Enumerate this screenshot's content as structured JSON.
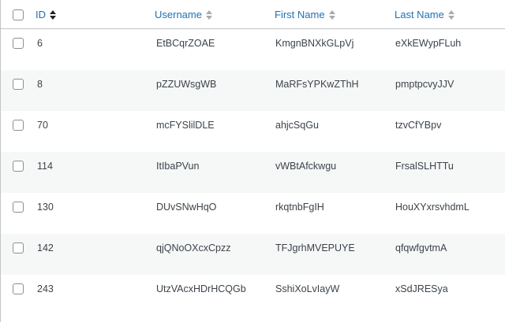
{
  "columns": {
    "id": "ID",
    "username": "Username",
    "first_name": "First Name",
    "last_name": "Last Name"
  },
  "rows": [
    {
      "id": "6",
      "username": "EtBCqrZOAE",
      "first_name": "KmgnBNXkGLpVj",
      "last_name": "eXkEWypFLuh"
    },
    {
      "id": "8",
      "username": "pZZUWsgWB",
      "first_name": "MaRFsYPKwZThH",
      "last_name": "pmptpcvyJJV"
    },
    {
      "id": "70",
      "username": "mcFYSlilDLE",
      "first_name": "ahjcSqGu",
      "last_name": "tzvCfYBpv"
    },
    {
      "id": "114",
      "username": "ItIbaPVun",
      "first_name": "vWBtAfckwgu",
      "last_name": "FrsalSLHTTu"
    },
    {
      "id": "130",
      "username": "DUvSNwHqO",
      "first_name": "rkqtnbFgIH",
      "last_name": "HouXYxrsvhdmL"
    },
    {
      "id": "142",
      "username": "qjQNoOXcxCpzz",
      "first_name": "TFJgrhMVEPUYE",
      "last_name": "qfqwfgvtmA"
    },
    {
      "id": "243",
      "username": "UtzVAcxHDrHCQGb",
      "first_name": "SshiXoLvIayW",
      "last_name": "xSdJRESya"
    }
  ],
  "colors": {
    "link": "#2271b1",
    "text": "#3c434a",
    "row_alt": "#f6f7f7",
    "border": "#c3c4c7"
  },
  "icons": {
    "sort_active": "sort-asc-icon",
    "sort_inactive": "sort-icon"
  }
}
